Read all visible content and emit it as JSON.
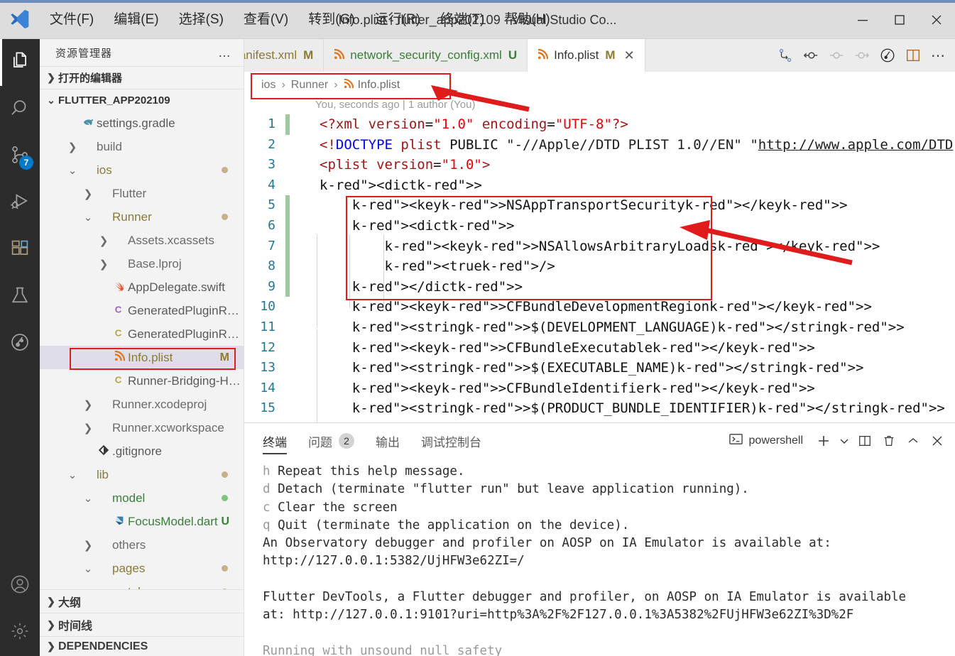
{
  "titlebar": {
    "menus": [
      "文件(F)",
      "编辑(E)",
      "选择(S)",
      "查看(V)",
      "转到(G)",
      "运行(R)",
      "终端(T)",
      "帮助(H)"
    ],
    "window_title": "Info.plist - flutter_app202109 - Visual Studio Co...",
    "minimize": "—",
    "maximize": "▢",
    "close": "✕"
  },
  "activitybar": {
    "items": [
      {
        "name": "explorer",
        "icon": "files-icon"
      },
      {
        "name": "search",
        "icon": "search-icon"
      },
      {
        "name": "source-control",
        "icon": "source-control-icon",
        "badge": "7"
      },
      {
        "name": "run-debug",
        "icon": "run-debug-icon"
      },
      {
        "name": "extensions",
        "icon": "extensions-icon"
      },
      {
        "name": "testing",
        "icon": "beaker-icon"
      },
      {
        "name": "flutter-outline",
        "icon": "flutter-inspector-icon"
      }
    ],
    "bottom": [
      {
        "name": "accounts",
        "icon": "account-icon"
      },
      {
        "name": "settings",
        "icon": "gear-icon"
      }
    ]
  },
  "sidebar": {
    "title": "资源管理器",
    "more_label": "…",
    "open_editors": "打开的编辑器",
    "project": "FLUTTER_APP202109",
    "outline": "大纲",
    "timeline": "时间线",
    "dependencies": "DEPENDENCIES",
    "tree": [
      {
        "label": "settings.gradle",
        "depth": 1,
        "type": "file",
        "icon": "gradle-icon",
        "twisty": "",
        "status": "",
        "dot": ""
      },
      {
        "label": "build",
        "depth": 1,
        "type": "folder",
        "icon": "",
        "twisty": "›",
        "status": "",
        "dot": ""
      },
      {
        "label": "ios",
        "depth": 1,
        "type": "folder",
        "icon": "",
        "twisty": "⌄",
        "status": "",
        "dot": "tan"
      },
      {
        "label": "Flutter",
        "depth": 2,
        "type": "folder",
        "icon": "",
        "twisty": "›",
        "status": "",
        "dot": ""
      },
      {
        "label": "Runner",
        "depth": 2,
        "type": "folder",
        "icon": "",
        "twisty": "⌄",
        "status": "",
        "dot": "tan"
      },
      {
        "label": "Assets.xcassets",
        "depth": 3,
        "type": "folder",
        "icon": "",
        "twisty": "›",
        "status": "",
        "dot": ""
      },
      {
        "label": "Base.lproj",
        "depth": 3,
        "type": "folder",
        "icon": "",
        "twisty": "›",
        "status": "",
        "dot": ""
      },
      {
        "label": "AppDelegate.swift",
        "depth": 3,
        "type": "file",
        "icon": "swift-icon",
        "twisty": "",
        "status": "",
        "dot": ""
      },
      {
        "label": "GeneratedPluginRegis...",
        "depth": 3,
        "type": "file",
        "icon": "c-icon",
        "twisty": "",
        "status": "",
        "dot": ""
      },
      {
        "label": "GeneratedPluginRegis...",
        "depth": 3,
        "type": "file",
        "icon": "h-icon",
        "twisty": "",
        "status": "",
        "dot": ""
      },
      {
        "label": "Info.plist",
        "depth": 3,
        "type": "file",
        "icon": "xml-icon",
        "twisty": "",
        "status": "M",
        "dot": "",
        "selected": true
      },
      {
        "label": "Runner-Bridging-Head...",
        "depth": 3,
        "type": "file",
        "icon": "h-icon",
        "twisty": "",
        "status": "",
        "dot": ""
      },
      {
        "label": "Runner.xcodeproj",
        "depth": 2,
        "type": "folder",
        "icon": "",
        "twisty": "›",
        "status": "",
        "dot": ""
      },
      {
        "label": "Runner.xcworkspace",
        "depth": 2,
        "type": "folder",
        "icon": "",
        "twisty": "›",
        "status": "",
        "dot": ""
      },
      {
        "label": ".gitignore",
        "depth": 2,
        "type": "file",
        "icon": "git-icon",
        "twisty": "",
        "status": "",
        "dot": ""
      },
      {
        "label": "lib",
        "depth": 1,
        "type": "folder",
        "icon": "",
        "twisty": "⌄",
        "status": "",
        "dot": "tan"
      },
      {
        "label": "model",
        "depth": 2,
        "type": "folder",
        "icon": "",
        "twisty": "⌄",
        "status": "",
        "dot": "green"
      },
      {
        "label": "FocusModel.dart",
        "depth": 3,
        "type": "file",
        "icon": "dart-icon",
        "twisty": "",
        "status": "U",
        "dot": ""
      },
      {
        "label": "others",
        "depth": 2,
        "type": "folder",
        "icon": "",
        "twisty": "›",
        "status": "",
        "dot": ""
      },
      {
        "label": "pages",
        "depth": 2,
        "type": "folder",
        "icon": "",
        "twisty": "⌄",
        "status": "",
        "dot": "tan"
      },
      {
        "label": "tabs",
        "depth": 3,
        "type": "folder",
        "icon": "",
        "twisty": "⌄",
        "status": "",
        "dot": "tan"
      }
    ]
  },
  "editor": {
    "tabs": [
      {
        "label": "oidManifest.xml",
        "status": "M",
        "icon": "",
        "active": false,
        "color": "gold",
        "clipped": true
      },
      {
        "label": "network_security_config.xml",
        "status": "U",
        "icon": "xml-icon",
        "active": false,
        "color": "green"
      },
      {
        "label": "Info.plist",
        "status": "M",
        "icon": "xml-icon",
        "active": true,
        "color": "gold",
        "close": "✕"
      }
    ],
    "toolbar_icons": [
      "compare-changes-icon",
      "revert-change-icon",
      "previous-change-icon",
      "next-change-icon",
      "timeline-icon",
      "split-editor-icon",
      "more-actions-icon"
    ],
    "breadcrumb": [
      "ios",
      "Runner",
      "Info.plist"
    ],
    "breadcrumb_sep": "›",
    "blame": "You, seconds ago | 1 author (You)",
    "lines": [
      {
        "n": "1",
        "modified": true,
        "text": "<?xml version=\"1.0\" encoding=\"UTF-8\"?>"
      },
      {
        "n": "2",
        "modified": false,
        "text": "<!DOCTYPE plist PUBLIC \"-//Apple//DTD PLIST 1.0//EN\" \"http://www.apple.com/DTD"
      },
      {
        "n": "3",
        "modified": false,
        "text": "<plist version=\"1.0\">"
      },
      {
        "n": "4",
        "modified": false,
        "text": "<dict>"
      },
      {
        "n": "5",
        "modified": true,
        "text": "    <key>NSAppTransportSecurity</key>"
      },
      {
        "n": "6",
        "modified": true,
        "text": "    <dict>"
      },
      {
        "n": "7",
        "modified": true,
        "text": "        <key>NSAllowsArbitraryLoads</key>"
      },
      {
        "n": "8",
        "modified": true,
        "text": "        <true/>"
      },
      {
        "n": "9",
        "modified": true,
        "text": "    </dict>"
      },
      {
        "n": "10",
        "modified": false,
        "text": "    <key>CFBundleDevelopmentRegion</key>"
      },
      {
        "n": "11",
        "modified": false,
        "text": "    <string>$(DEVELOPMENT_LANGUAGE)</string>"
      },
      {
        "n": "12",
        "modified": false,
        "text": "    <key>CFBundleExecutable</key>"
      },
      {
        "n": "13",
        "modified": false,
        "text": "    <string>$(EXECUTABLE_NAME)</string>"
      },
      {
        "n": "14",
        "modified": false,
        "text": "    <key>CFBundleIdentifier</key>"
      },
      {
        "n": "15",
        "modified": false,
        "text": "    <string>$(PRODUCT_BUNDLE_IDENTIFIER)</string>"
      }
    ]
  },
  "panel": {
    "tabs": [
      {
        "label": "终端",
        "active": true,
        "badge": ""
      },
      {
        "label": "问题",
        "active": false,
        "badge": "2"
      },
      {
        "label": "输出",
        "active": false,
        "badge": ""
      },
      {
        "label": "调试控制台",
        "active": false,
        "badge": ""
      }
    ],
    "shell": "powershell",
    "actions": [
      "new-terminal-icon",
      "dropdown-chevron-icon",
      "split-terminal-icon",
      "kill-terminal-icon",
      "collapse-panel-icon",
      "close-panel-icon"
    ],
    "terminal_lines": [
      {
        "prefix": "h",
        "text": " Repeat this help message."
      },
      {
        "prefix": "d",
        "text": " Detach (terminate \"flutter run\" but leave application running)."
      },
      {
        "prefix": "c",
        "text": " Clear the screen"
      },
      {
        "prefix": "q",
        "text": " Quit (terminate the application on the device)."
      },
      {
        "prefix": "",
        "text": "An Observatory debugger and profiler on AOSP on IA Emulator is available at:"
      },
      {
        "prefix": "",
        "text": "http://127.0.0.1:5382/UjHFW3e62ZI=/"
      },
      {
        "prefix": "",
        "text": ""
      },
      {
        "prefix": "",
        "text": "Flutter DevTools, a Flutter debugger and profiler, on AOSP on IA Emulator is available"
      },
      {
        "prefix": "",
        "text": "at: http://127.0.0.1:9101?uri=http%3A%2F%2F127.0.0.1%3A5382%2FUjHFW3e62ZI%3D%2F"
      },
      {
        "prefix": "",
        "text": ""
      },
      {
        "prefix": "",
        "text": "Running with unsound null safety",
        "dim": true
      }
    ]
  },
  "annotations": {
    "accent_color": "#e01b1b",
    "boxes": [
      {
        "name": "breadcrumb-highlight"
      },
      {
        "name": "code-block-highlight"
      },
      {
        "name": "sidebar-file-highlight"
      }
    ],
    "arrows": [
      {
        "name": "arrow-to-breadcrumb"
      },
      {
        "name": "arrow-to-code-block"
      }
    ]
  }
}
